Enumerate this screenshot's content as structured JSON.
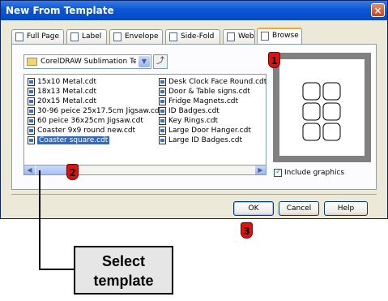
{
  "window": {
    "title": "New From Template",
    "close_glyph": "×"
  },
  "tabs": [
    {
      "label": "Full Page",
      "icon": "page-icon"
    },
    {
      "label": "Label",
      "icon": "label-icon"
    },
    {
      "label": "Envelope",
      "icon": "envelope-icon"
    },
    {
      "label": "Side-Fold",
      "icon": "side-fold-icon"
    },
    {
      "label": "Web",
      "icon": "web-icon"
    },
    {
      "label": "Browse",
      "icon": "browse-icon",
      "active": true
    }
  ],
  "folder_select": {
    "value": "CorelDRAW Sublimation Temp",
    "icon": "folder-icon"
  },
  "up_button": {
    "icon": "up-folder-icon",
    "glyph": "⤴"
  },
  "files_col1": [
    "15x10 Metal.cdt",
    "18x13 Metal.cdt",
    "20x15 Metal.cdt",
    "30-96 peice 25x17.5cm Jigsaw.cdt",
    "60 peice 36x25cm Jigsaw.cdt",
    "Coaster 9x9 round new.cdt",
    "Coaster square.cdt"
  ],
  "files_col2": [
    "Desk Clock Face Round.cdt",
    "Door & Table signs.cdt",
    "Fridge Magnets.cdt",
    "ID Badges.cdt",
    "Key Rings.cdt",
    "Large Door Hanger.cdt",
    "Large ID Badges.cdt"
  ],
  "selected_file": "Coaster square.cdt",
  "include_graphics": {
    "label": "Include graphics",
    "checked": true
  },
  "buttons": {
    "ok": "OK",
    "cancel": "Cancel",
    "help": "Help"
  },
  "markers": [
    "1",
    "2",
    "3"
  ],
  "callout": {
    "line1": "Select",
    "line2": "template"
  },
  "colors": {
    "selection": "#316ac5",
    "titlebar": "#0b56d8",
    "marker": "#e01010",
    "active_tab_accent": "#f1a72d"
  }
}
